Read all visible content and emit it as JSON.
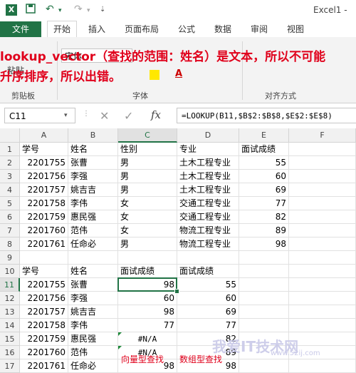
{
  "title_bar": {
    "app_title": "Excel1 -"
  },
  "ribbon": {
    "tabs": [
      "文件",
      "开始",
      "插入",
      "页面布局",
      "公式",
      "数据",
      "审阅",
      "视图"
    ],
    "active_tab": "开始",
    "paste_label": "粘贴",
    "font_name": "宋体",
    "groups": [
      "剪贴板",
      "字体",
      "对齐方式"
    ]
  },
  "overlay_note": {
    "line1": "lookup_vector（查找的范围：姓名）是文本，所以不可能",
    "line2": "升序排序，所以出错。"
  },
  "formula_bar": {
    "name_box": "C11",
    "fx_label": "fx",
    "formula": "=LOOKUP(B11,$B$2:$B$8,$E$2:$E$8)"
  },
  "grid": {
    "columns": [
      "A",
      "B",
      "C",
      "D",
      "E",
      "F"
    ],
    "selected_column": "C",
    "selected_row": "11",
    "rows": [
      {
        "n": "1",
        "cells": [
          {
            "col": "A",
            "v": "学号"
          },
          {
            "col": "B",
            "v": "姓名"
          },
          {
            "col": "C",
            "v": "性别"
          },
          {
            "col": "D",
            "v": "专业"
          },
          {
            "col": "E",
            "v": "面试成绩"
          }
        ]
      },
      {
        "n": "2",
        "cells": [
          {
            "col": "A",
            "v": "2201755",
            "num": true
          },
          {
            "col": "B",
            "v": "张曹"
          },
          {
            "col": "C",
            "v": "男"
          },
          {
            "col": "D",
            "v": "土木工程专业"
          },
          {
            "col": "E",
            "v": "55",
            "num": true
          }
        ]
      },
      {
        "n": "3",
        "cells": [
          {
            "col": "A",
            "v": "2201756",
            "num": true
          },
          {
            "col": "B",
            "v": "李强"
          },
          {
            "col": "C",
            "v": "男"
          },
          {
            "col": "D",
            "v": "土木工程专业"
          },
          {
            "col": "E",
            "v": "60",
            "num": true
          }
        ]
      },
      {
        "n": "4",
        "cells": [
          {
            "col": "A",
            "v": "2201757",
            "num": true
          },
          {
            "col": "B",
            "v": "姚吉吉"
          },
          {
            "col": "C",
            "v": "男"
          },
          {
            "col": "D",
            "v": "土木工程专业"
          },
          {
            "col": "E",
            "v": "69",
            "num": true
          }
        ]
      },
      {
        "n": "5",
        "cells": [
          {
            "col": "A",
            "v": "2201758",
            "num": true
          },
          {
            "col": "B",
            "v": "李伟"
          },
          {
            "col": "C",
            "v": "女"
          },
          {
            "col": "D",
            "v": "交通工程专业"
          },
          {
            "col": "E",
            "v": "77",
            "num": true
          }
        ]
      },
      {
        "n": "6",
        "cells": [
          {
            "col": "A",
            "v": "2201759",
            "num": true
          },
          {
            "col": "B",
            "v": "惠民强"
          },
          {
            "col": "C",
            "v": "女"
          },
          {
            "col": "D",
            "v": "交通工程专业"
          },
          {
            "col": "E",
            "v": "82",
            "num": true
          }
        ]
      },
      {
        "n": "7",
        "cells": [
          {
            "col": "A",
            "v": "2201760",
            "num": true
          },
          {
            "col": "B",
            "v": "范伟"
          },
          {
            "col": "C",
            "v": "女"
          },
          {
            "col": "D",
            "v": "物流工程专业"
          },
          {
            "col": "E",
            "v": "89",
            "num": true
          }
        ]
      },
      {
        "n": "8",
        "cells": [
          {
            "col": "A",
            "v": "2201761",
            "num": true
          },
          {
            "col": "B",
            "v": "任命必"
          },
          {
            "col": "C",
            "v": "男"
          },
          {
            "col": "D",
            "v": "物流工程专业"
          },
          {
            "col": "E",
            "v": "98",
            "num": true
          }
        ]
      },
      {
        "n": "9",
        "cells": []
      },
      {
        "n": "10",
        "cells": [
          {
            "col": "A",
            "v": "学号"
          },
          {
            "col": "B",
            "v": "姓名"
          },
          {
            "col": "C",
            "v": "面试成绩"
          },
          {
            "col": "D",
            "v": "面试成绩"
          }
        ]
      },
      {
        "n": "11",
        "cells": [
          {
            "col": "A",
            "v": "2201755",
            "num": true
          },
          {
            "col": "B",
            "v": "张曹"
          },
          {
            "col": "C",
            "v": "98",
            "num": true
          },
          {
            "col": "D",
            "v": "55",
            "num": true
          }
        ]
      },
      {
        "n": "12",
        "cells": [
          {
            "col": "A",
            "v": "2201756",
            "num": true
          },
          {
            "col": "B",
            "v": "李强"
          },
          {
            "col": "C",
            "v": "60",
            "num": true
          },
          {
            "col": "D",
            "v": "60",
            "num": true
          }
        ]
      },
      {
        "n": "13",
        "cells": [
          {
            "col": "A",
            "v": "2201757",
            "num": true
          },
          {
            "col": "B",
            "v": "姚吉吉"
          },
          {
            "col": "C",
            "v": "98",
            "num": true
          },
          {
            "col": "D",
            "v": "69",
            "num": true
          }
        ]
      },
      {
        "n": "14",
        "cells": [
          {
            "col": "A",
            "v": "2201758",
            "num": true
          },
          {
            "col": "B",
            "v": "李伟"
          },
          {
            "col": "C",
            "v": "77",
            "num": true
          },
          {
            "col": "D",
            "v": "77",
            "num": true
          }
        ]
      },
      {
        "n": "15",
        "cells": [
          {
            "col": "A",
            "v": "2201759",
            "num": true
          },
          {
            "col": "B",
            "v": "惠民强"
          },
          {
            "col": "C",
            "v": "#N/A",
            "err": true
          },
          {
            "col": "D",
            "v": "82",
            "num": true
          }
        ]
      },
      {
        "n": "16",
        "cells": [
          {
            "col": "A",
            "v": "2201760",
            "num": true
          },
          {
            "col": "B",
            "v": "范伟"
          },
          {
            "col": "C",
            "v": "#N/A",
            "err": true
          },
          {
            "col": "D",
            "v": "89",
            "num": true
          }
        ]
      },
      {
        "n": "17",
        "cells": [
          {
            "col": "A",
            "v": "2201761",
            "num": true
          },
          {
            "col": "B",
            "v": "任命必"
          },
          {
            "col": "C",
            "v": "98",
            "num": true
          },
          {
            "col": "D",
            "v": "98",
            "num": true
          }
        ]
      }
    ],
    "annotations": [
      "向量型查找",
      "数组型查找"
    ]
  },
  "watermark": {
    "text": "我爱IT技术网",
    "url": "www.52ij.com"
  }
}
